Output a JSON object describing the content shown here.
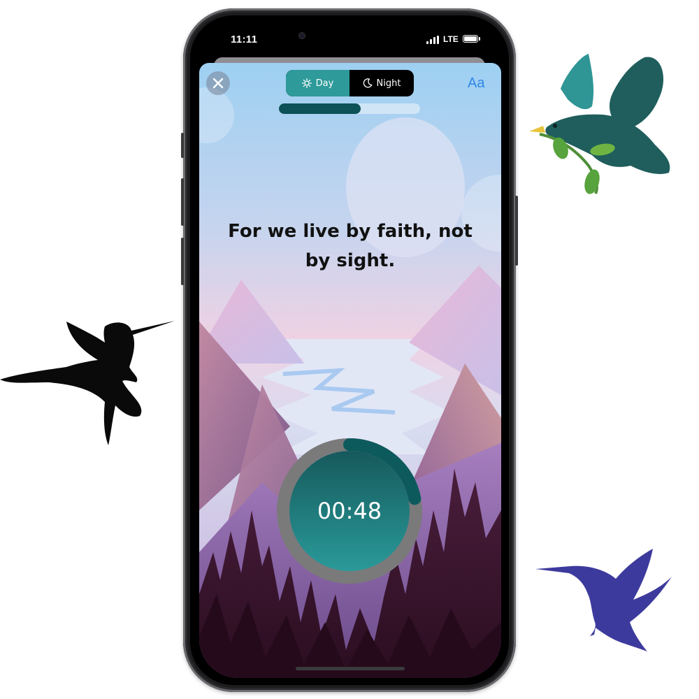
{
  "status_bar": {
    "time": "11:11",
    "network": "LTE"
  },
  "header": {
    "close_icon": "close-icon",
    "toggle": {
      "day_label": "Day",
      "day_icon": "sun-icon",
      "night_label": "Night",
      "night_icon": "moon-icon",
      "selected": "Day"
    },
    "font_size_label": "Aa"
  },
  "progress": {
    "fraction": 0.58
  },
  "verse": {
    "text": "For we live by faith, not by sight."
  },
  "timer": {
    "time": "00:48",
    "ring_fraction": 0.22
  },
  "colors": {
    "accent_teal": "#2e9a9a",
    "progress_dark": "#0c5257",
    "font_button_blue": "#2f86e8",
    "timer_ring_grey": "#7a7a7a"
  },
  "decorations": {
    "birds": [
      "dove-with-olive-branch",
      "black-hummingbird",
      "blue-hummingbird"
    ]
  }
}
